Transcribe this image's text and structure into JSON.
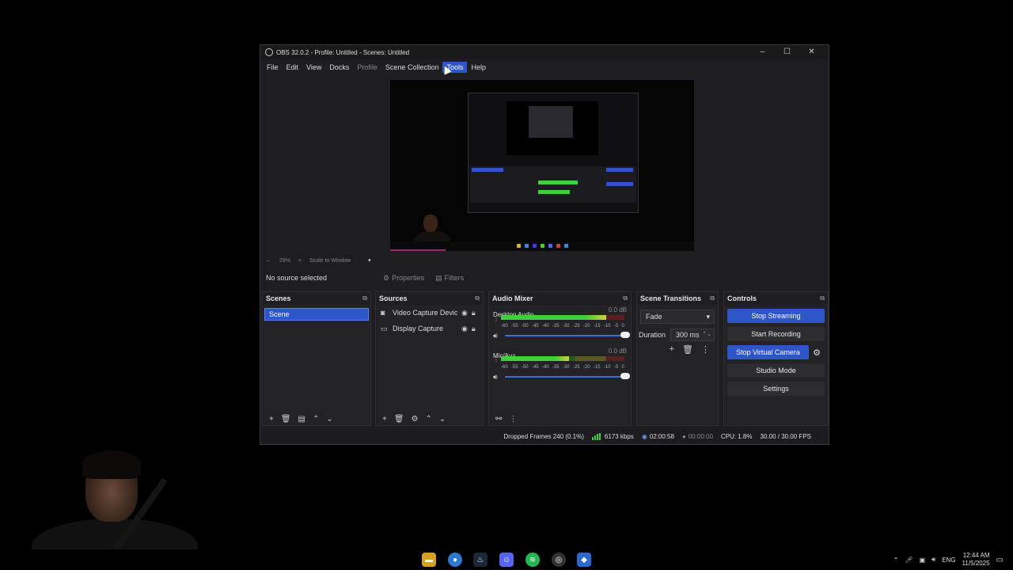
{
  "window": {
    "title": "OBS 32.0.2 - Profile: Untitled - Scenes: Untitled",
    "minimize": "–",
    "maximize": "☐",
    "close": "✕"
  },
  "menu": [
    "File",
    "Edit",
    "View",
    "Docks",
    "Profile",
    "Scene Collection",
    "Tools",
    "Help"
  ],
  "zoom": {
    "minus": "–",
    "percent": "29%",
    "plus": "+",
    "mode": "Scale to Window",
    "arrow": "▾"
  },
  "source_toolbar": {
    "no_source": "No source selected",
    "properties": "Properties",
    "filters": "Filters"
  },
  "scenes": {
    "title": "Scenes",
    "items": [
      "Scene"
    ]
  },
  "sources": {
    "title": "Sources",
    "items": [
      {
        "label": "Video Capture Devic",
        "icon": "camera-icon"
      },
      {
        "label": "Display Capture",
        "icon": "monitor-icon"
      }
    ]
  },
  "mixer": {
    "title": "Audio Mixer",
    "channels": [
      {
        "name": "Desktop Audio",
        "db": "0.0 dB",
        "level": 0.85
      },
      {
        "name": "Mic/Aux",
        "db": "0.0 dB",
        "level": 0.55
      }
    ],
    "ticks": [
      "-60",
      "-55",
      "-50",
      "-45",
      "-40",
      "-35",
      "-30",
      "-25",
      "-20",
      "-15",
      "-10",
      "-5",
      "0"
    ]
  },
  "transitions": {
    "title": "Scene Transitions",
    "selected": "Fade",
    "duration_label": "Duration",
    "duration_value": "300 ms"
  },
  "controls": {
    "title": "Controls",
    "stop_streaming": "Stop Streaming",
    "start_recording": "Start Recording",
    "stop_virtual_camera": "Stop Virtual Camera",
    "studio_mode": "Studio Mode",
    "settings": "Settings"
  },
  "status": {
    "dropped_frames": "Dropped Frames 240 (0.1%)",
    "bitrate": "6173 kbps",
    "stream_time": "02:00:58",
    "record_time": "00:00:00",
    "cpu": "CPU: 1.8%",
    "fps": "30.00 / 30.00 FPS"
  },
  "taskbar": {
    "lang": "ENG",
    "time": "12:44 AM",
    "date": "11/5/2025"
  },
  "colors": {
    "accent": "#2f56c9",
    "meter_green": "#3fcf3f",
    "meter_yellow": "#cfcf3f",
    "meter_red": "#cf3f3f"
  }
}
